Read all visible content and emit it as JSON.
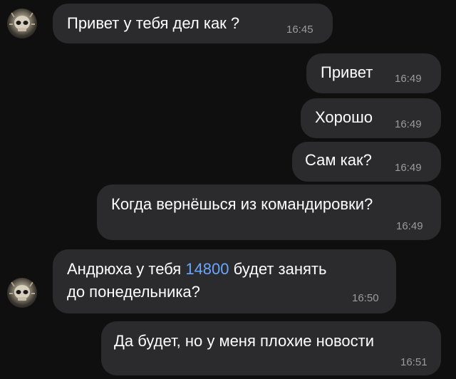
{
  "messages": [
    {
      "side": "in",
      "text": "Привет у тебя дел как ?",
      "time": "16:45"
    },
    {
      "side": "out",
      "text": "Привет",
      "time": "16:49"
    },
    {
      "side": "out",
      "text": "Хорошо",
      "time": "16:49"
    },
    {
      "side": "out",
      "text": "Сам как?",
      "time": "16:49"
    },
    {
      "side": "out",
      "text": "Когда вернёшься из командировки?",
      "time": "16:49"
    },
    {
      "side": "in",
      "text_line1_start": "Андрюха у тебя ",
      "text_line1_link": "14800",
      "text_line1_end": " будет занять",
      "text_line2": "до понедельника?",
      "time": "16:50"
    },
    {
      "side": "out",
      "text": "Да будет, но у меня плохие новости",
      "time": "16:51"
    }
  ],
  "colors": {
    "background": "#0f0f0f",
    "bubble": "#2b2b2d",
    "link": "#6aa6ff",
    "time": "#9b9b9f"
  },
  "avatar_icon": "skull-emblem-icon"
}
